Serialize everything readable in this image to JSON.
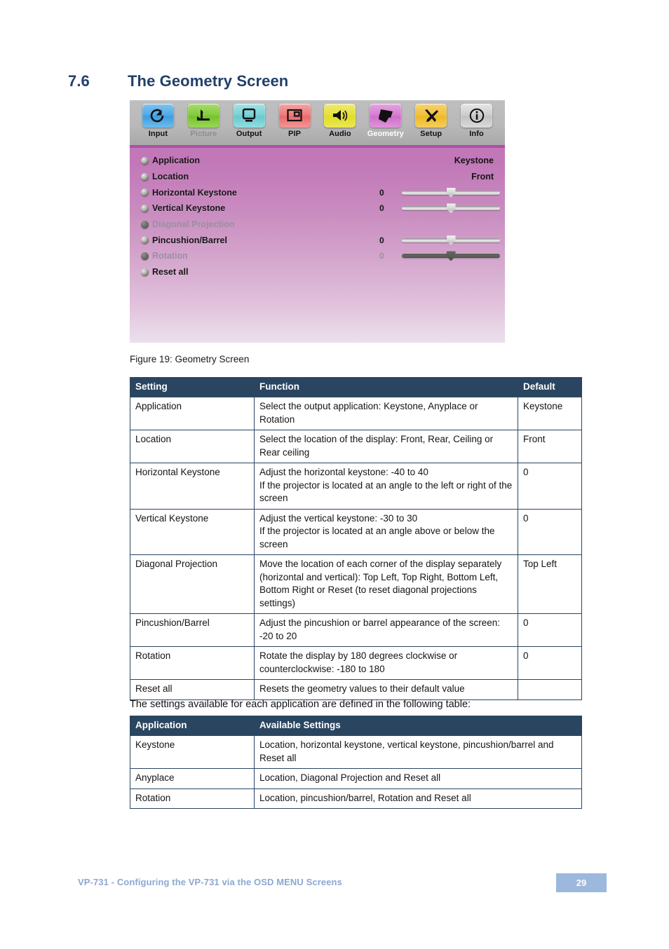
{
  "heading": {
    "number": "7.6",
    "title": "The Geometry Screen"
  },
  "osd": {
    "toolbar": [
      {
        "label": "Input",
        "icon": "input-icon",
        "state": "normal"
      },
      {
        "label": "Picture",
        "icon": "picture-icon",
        "state": "dim"
      },
      {
        "label": "Output",
        "icon": "output-icon",
        "state": "normal"
      },
      {
        "label": "PIP",
        "icon": "pip-icon",
        "state": "normal"
      },
      {
        "label": "Audio",
        "icon": "audio-icon",
        "state": "normal"
      },
      {
        "label": "Geometry",
        "icon": "geometry-icon",
        "state": "selected"
      },
      {
        "label": "Setup",
        "icon": "setup-icon",
        "state": "normal"
      },
      {
        "label": "Info",
        "icon": "info-icon",
        "state": "normal"
      }
    ],
    "rows": [
      {
        "name": "Application",
        "value": "Keystone",
        "number": "",
        "slider": "none",
        "enabled": true
      },
      {
        "name": "Location",
        "value": "Front",
        "number": "",
        "slider": "none",
        "enabled": true
      },
      {
        "name": "Horizontal Keystone",
        "value": "",
        "number": "0",
        "slider": "enabled",
        "position": 50,
        "enabled": true
      },
      {
        "name": "Vertical Keystone",
        "value": "",
        "number": "0",
        "slider": "enabled",
        "position": 50,
        "enabled": true
      },
      {
        "name": "Diagonal Projection",
        "value": "",
        "number": "",
        "slider": "none",
        "enabled": false
      },
      {
        "name": "Pincushion/Barrel",
        "value": "",
        "number": "0",
        "slider": "enabled",
        "position": 50,
        "enabled": true
      },
      {
        "name": "Rotation",
        "value": "",
        "number": "0",
        "slider": "disabled",
        "position": 50,
        "enabled": false
      },
      {
        "name": "Reset all",
        "value": "",
        "number": "",
        "slider": "none",
        "enabled": true
      }
    ]
  },
  "figure_caption": "Figure 19: Geometry Screen",
  "settings_table": {
    "headers": [
      "Setting",
      "Function",
      "Default"
    ],
    "rows": [
      {
        "setting": "Application",
        "function": "Select the output application: Keystone, Anyplace or Rotation",
        "default": "Keystone"
      },
      {
        "setting": "Location",
        "function": "Select the location of the display: Front, Rear, Ceiling or Rear ceiling",
        "default": "Front"
      },
      {
        "setting": "Horizontal Keystone",
        "function": "Adjust the horizontal keystone: -40 to 40",
        "function2": "If the projector is located at an angle to the left or right of the screen",
        "default": "0"
      },
      {
        "setting": "Vertical Keystone",
        "function": "Adjust the vertical keystone: -30 to 30",
        "function2": "If the projector is located at an angle above or below the screen",
        "default": "0"
      },
      {
        "setting": "Diagonal Projection",
        "function": "Move the location of each corner of the display separately (horizontal and vertical): Top Left, Top Right, Bottom Left, Bottom Right or Reset (to reset diagonal projections settings)",
        "default": "Top Left"
      },
      {
        "setting": "Pincushion/Barrel",
        "function": "Adjust the pincushion or barrel appearance of the screen: -20 to 20",
        "default": "0"
      },
      {
        "setting": "Rotation",
        "function": "Rotate the display by 180 degrees clockwise or counterclockwise: -180 to 180",
        "default": "0"
      },
      {
        "setting": "Reset all",
        "function": "Resets the geometry values to their default value",
        "default": ""
      }
    ]
  },
  "intro_text": "The settings available for each application are defined in the following table:",
  "applications_table": {
    "headers": [
      "Application",
      "Available Settings"
    ],
    "rows": [
      {
        "application": "Keystone",
        "settings": "Location, horizontal keystone, vertical keystone, pincushion/barrel and Reset all"
      },
      {
        "application": "Anyplace",
        "settings": "Location, Diagonal Projection and Reset all"
      },
      {
        "application": "Rotation",
        "settings": "Location, pincushion/barrel, Rotation and Reset all"
      }
    ]
  },
  "footer": {
    "text": "VP-731 - Configuring the VP-731 via the OSD MENU Screens",
    "page": "29"
  },
  "colors": {
    "heading": "#22406a",
    "table_header_bg": "#2a4560",
    "footer_text": "#8ba8d3",
    "page_badge_bg": "#9cb8dd",
    "osd_accent": "#ae4fa5"
  }
}
